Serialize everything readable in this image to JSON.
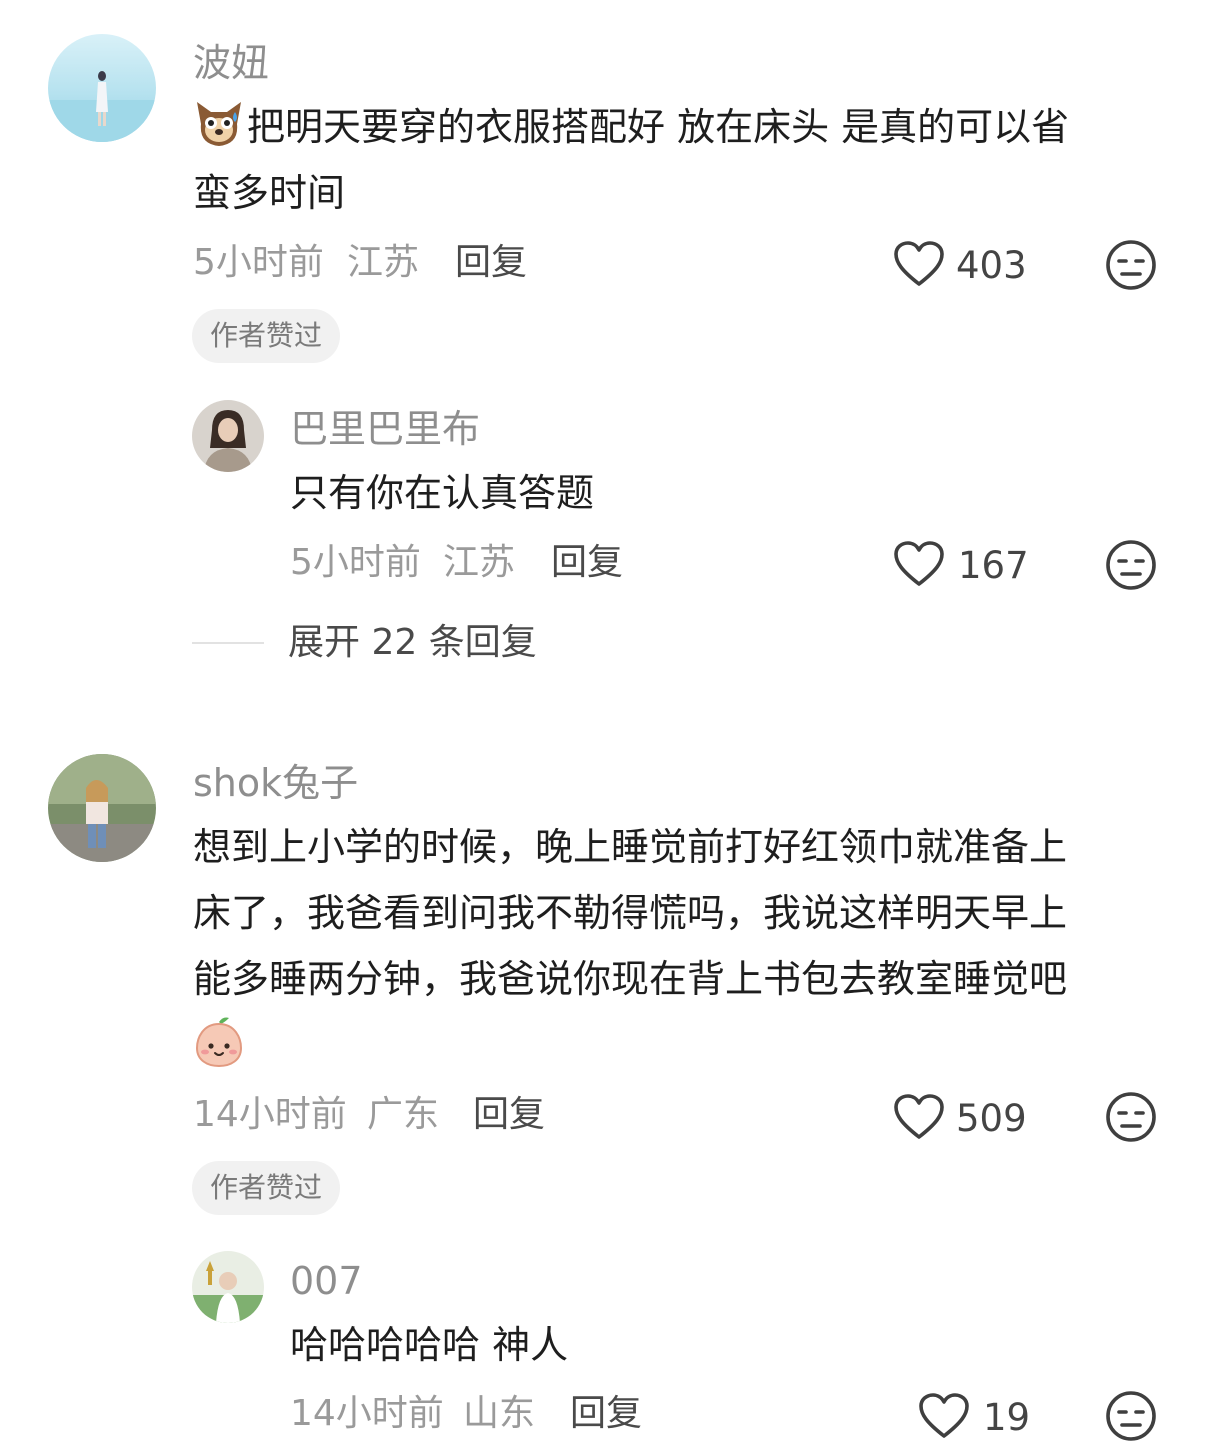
{
  "comments": [
    {
      "username": "波妞",
      "text_line1": "把明天要穿的衣服搭配好 放在床头 是真的可以省",
      "text_line2": "蛮多时间",
      "time": "5小时前",
      "location": "江苏",
      "reply_label": "回复",
      "likes": "403",
      "badge": "作者赞过",
      "reply": {
        "username": "巴里巴里布",
        "text": "只有你在认真答题",
        "time": "5小时前",
        "location": "江苏",
        "reply_label": "回复",
        "likes": "167"
      },
      "expand_label": "展开 22 条回复"
    },
    {
      "username": "shok兔子",
      "text_line1": "想到上小学的时候，晚上睡觉前打好红领巾就准备上",
      "text_line2": "床了，我爸看到问我不勒得慌吗，我说这样明天早上",
      "text_line3": "能多睡两分钟，我爸说你现在背上书包去教室睡觉吧",
      "time": "14小时前",
      "location": "广东",
      "reply_label": "回复",
      "likes": "509",
      "badge": "作者赞过",
      "reply": {
        "username": "007",
        "text": "哈哈哈哈哈 神人",
        "time": "14小时前",
        "location": "山东",
        "reply_label": "回复",
        "likes": "19"
      }
    }
  ],
  "icons": {
    "like": "heart-outline-icon",
    "dislike": "meh-face-icon",
    "emoji1": "dog-sweat-emoji",
    "emoji2": "peach-blush-emoji"
  }
}
